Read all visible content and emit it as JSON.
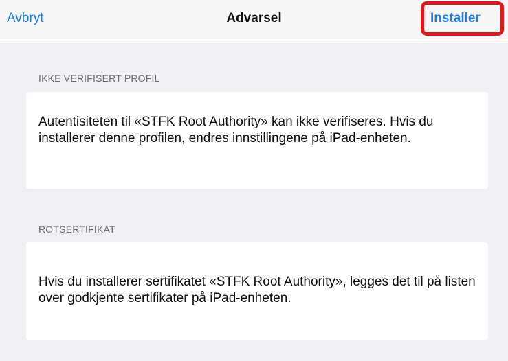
{
  "navbar": {
    "cancel_label": "Avbryt",
    "title": "Advarsel",
    "install_label": "Installer",
    "accent_color": "#1b7cf2",
    "highlight_color": "#e3161c"
  },
  "sections": [
    {
      "header": "IKKE VERIFISERT PROFIL",
      "text": "Autentisiteten til «STFK Root Authority» kan ikke verifiseres. Hvis du installerer denne profilen, endres innstillingene på iPad-enheten."
    },
    {
      "header": "ROTSERTIFIKAT",
      "text": "Hvis du installerer sertifikatet «STFK Root Authority», legges det til på listen over godkjente sertifikater på iPad-enheten."
    }
  ]
}
